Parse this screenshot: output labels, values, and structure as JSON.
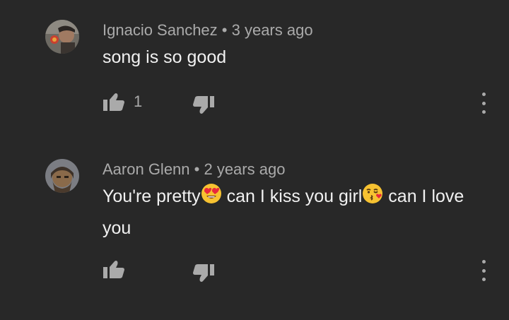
{
  "comments": [
    {
      "author": "Ignacio Sanchez",
      "time": "3 years ago",
      "text": "song is so good",
      "likes": "1",
      "icons": {
        "like": "thumbs-up-icon",
        "dislike": "thumbs-down-icon",
        "more": "vertical-dots-icon"
      }
    },
    {
      "author": "Aaron Glenn",
      "time": "2 years ago",
      "text_part1": "You're pretty",
      "text_part2": " can I kiss you girl",
      "text_part3": " can I love you",
      "emoji1": "heart-eyes-emoji",
      "emoji2": "kissing-face-emoji",
      "icons": {
        "like": "thumbs-up-icon",
        "dislike": "thumbs-down-icon",
        "more": "vertical-dots-icon"
      }
    }
  ],
  "separator": " • ",
  "colors": {
    "background": "#282828",
    "primary_text": "#f1f1f1",
    "secondary_text": "#aaaaaa"
  }
}
